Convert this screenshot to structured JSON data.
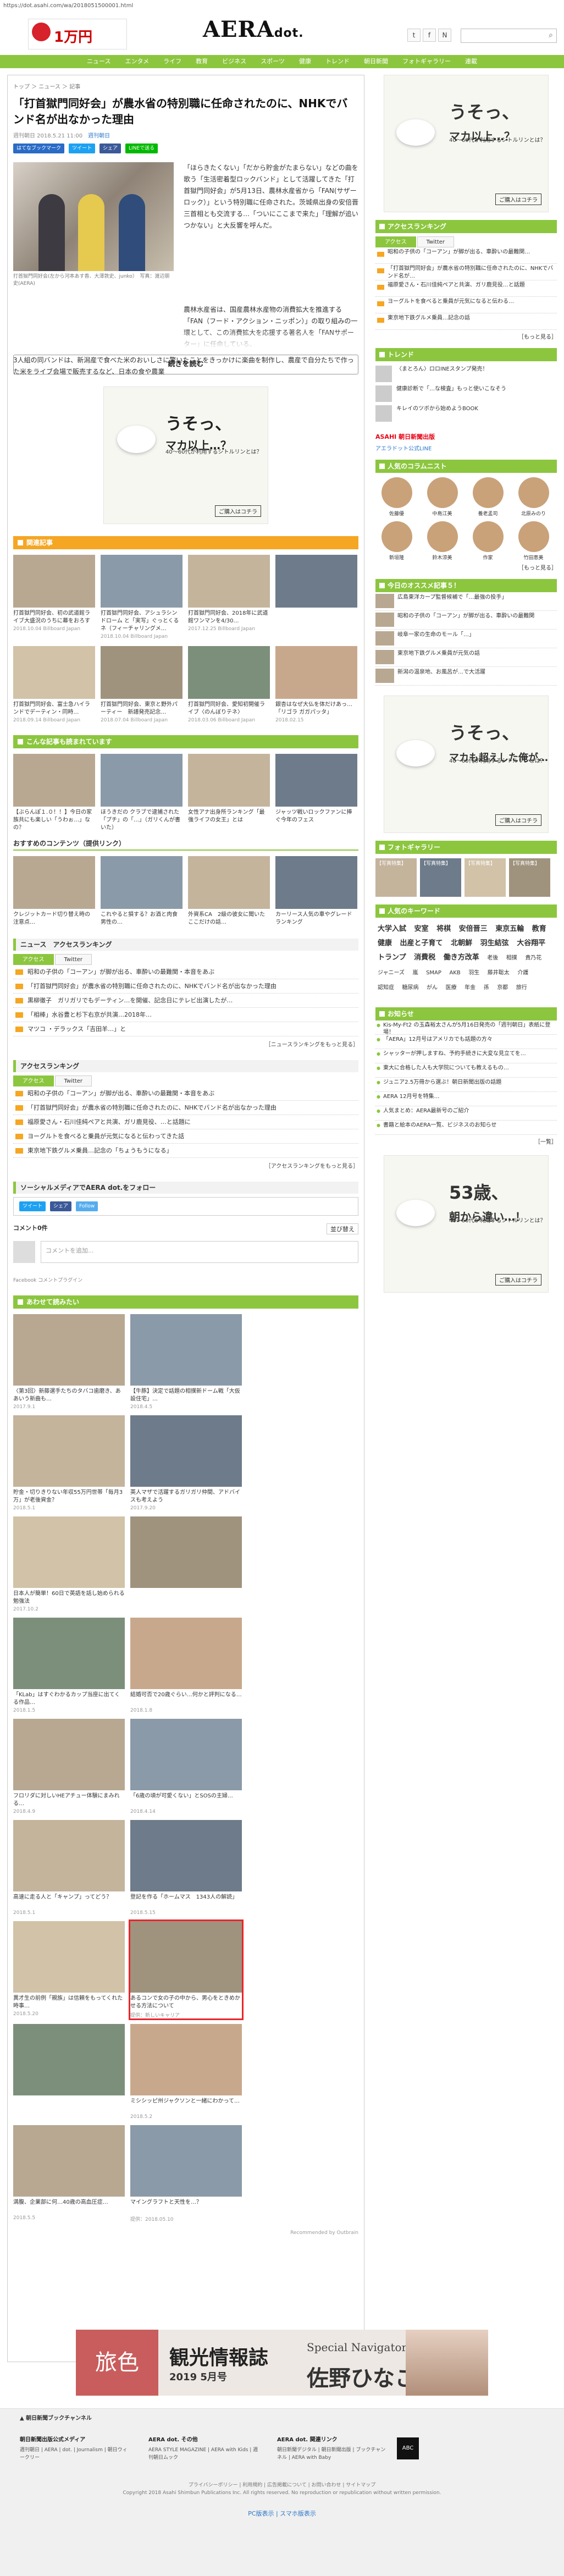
{
  "url": "https://dot.asahi.com/wa/2018051500001.html",
  "header": {
    "ad_big": "1万円",
    "ad_small": "2つの出版社が合同でAmazonギフト券プレゼント",
    "logo": "AERA",
    "logo_suffix": "dot.",
    "social": [
      "t",
      "f",
      "N"
    ],
    "search_icon": "search-icon"
  },
  "nav": [
    "ニュース",
    "エンタメ",
    "ライフ",
    "教育",
    "ビジネス",
    "スポーツ",
    "健康",
    "トレンド",
    "朝日新聞",
    "フォトギャラリー",
    "連載"
  ],
  "breadcrumb": "トップ ＞ ニュース ＞ 記事",
  "article": {
    "title": "「打首獄門同好会」が農水省の特別職に任命されたのに、NHKでバンド名が出なかった理由",
    "date": "週刊朝日 2018.5.21 11:00",
    "author": "週刊朝日",
    "share": [
      "はてなブックマーク",
      "ツイート",
      "シェア",
      "LINEで送る"
    ],
    "caption": "打首獄門同好会(左から河本あす香、大澤敦史、junko）　写真：渡辺朋史(AERA)",
    "para1": "「ほらきたくない」「だから貯金がたまらない」などの曲を歌う「生活密着型ロックバンド」として活躍してきた「打首獄門同好会」が5月13日、農林水産省から「FAN(サザーロック）」という特別職に任命された。茨城県出身の安倍晋三首相とも交流する…「ついにここまで来た」「理解が追いつかない」と大反響を呼んだ。",
    "para2": "農林水産省は、国産農林水産物の消費拡大を推進する「FAN（フード・アクション・ニッポン）」の取り組みの一環として、この消費拡大を応援する著名人を「FANサポーター」に任命している。",
    "para3": "3人組の同バンドは、新潟産で食べた米のおいしさに驚いたことをきっかけに楽曲を制作し、農産で自分たちで作った米をライブ会場で販売するなど、日本の食や農業",
    "more": "続きを読む"
  },
  "ad": {
    "q": "うそっ、",
    "q2": "マカ以上…？",
    "s": "40～60代が利用するシトルリンとは？",
    "btn": "ご購入はコチラ"
  },
  "related": {
    "title": "関連記事",
    "items": [
      {
        "t": "打首獄門同好会、初の武道館ライブ大盛況のうちに幕をおろす",
        "s": "2018.10.04 Billboard Japan"
      },
      {
        "t": "打首獄門同好会、アシュラシンドローム と「実写」ぐっとくるネ（フィーチャリングメ…",
        "s": "2018.10.04 Billboard Japan"
      },
      {
        "t": "打首獄門同好会、2018年に武道館ワンマンを4/30…",
        "s": "2017.12.25 Billboard Japan"
      },
      {
        "t": "",
        "s": ""
      },
      {
        "t": "打首獄門同好会、富士急ハイランドでデーティン・同時…",
        "s": "2018.09.14 Billboard Japan"
      },
      {
        "t": "打首獄門同好会、東京と野外パーティー　新譜発売記念…",
        "s": "2018.07.04 Billboard Japan"
      },
      {
        "t": "打首獄門同好会、愛知初開催ライブ〈のんぼりテネ〉",
        "s": "2018.03.06 Billboard Japan"
      },
      {
        "t": "銀杏はなぜ大仏を体だけあっ…「リゴラ ガガパッタ」",
        "s": "2018.02.15"
      }
    ]
  },
  "recommend": {
    "title": "こんな記事も読まれています",
    "items": [
      "【ぶらんぽ１.０！！】今日の家族共にも楽しい「うわぉ…」なの？",
      "ほうきだの クラブで逮捕された「プチ」の「…」（ガリくんが書いた）",
      "女性アナ出身所ランキング「最強ライフの女王」とは",
      "ジャッツ戦いロックファンに捧ぐ今年のフェス"
    ],
    "sponsored_title": "おすすめのコンテンツ（提供リンク）",
    "sponsored": [
      "クレジットカード切り替え時の注意点…",
      "これやると損する？お酒と肉食男性の…",
      "外資系CA　2級の彼女に聞いたここだけの話…",
      "カーリース人気の車やグレードランキング"
    ]
  },
  "news_ranking": {
    "title": "ニュース　アクセスランキング",
    "tabs": [
      "アクセス",
      "Twitter"
    ],
    "items": [
      "昭和の子供の「コーアン」が脚が出る、車酔いの最難関・本音をあぶ",
      "「打首獄門同好会」が農水省の特別職に任命されたのに、NHKでバンド名が出なかった理由",
      "黒柳徹子　ガリガリでもデーティン…を開催、記念日にテレビ出演したが…",
      "「相棒」水谷豊と杉下右京が共演…2018年…",
      "マツコ ・デラックス「吉田羊…」と"
    ],
    "more": "［ニュースランキングをもっと見る］"
  },
  "access_ranking": {
    "title": "アクセスランキング",
    "tabs": [
      "アクセス",
      "Twitter"
    ],
    "items": [
      "昭和の子供の「コーアン」が脚が出る、車酔いの最難関・本音をあぶ",
      "「打首獄門同好会」が農水省の特別職に任命されたのに、NHKでバンド名が出なかった理由",
      "福原愛さん・石川佳純ペアと共演、ガリ鹿見役、…と話題に",
      "ヨーグルトを食べると乗員が元気になると伝わってきた話",
      "東京地下鉄グルメ乗員…記念の「ちょうもうになる」"
    ],
    "more": "［アクセスランキングをもっと見る］"
  },
  "follow": {
    "title": "ソーシャルメディアでAERA dot.をフォロー",
    "btns": [
      "ツイート",
      "シェア",
      "Follow"
    ]
  },
  "comments": {
    "title": "コメント0件",
    "sort": "並び替え",
    "placeholder": "コメントを追加...",
    "plugin": "Facebook コメントプラグイン"
  },
  "also": {
    "title": "あわせて読みたい",
    "items": [
      {
        "t": "〈第3回〉新藤選手たちのタバコ歯磨き、ああいう新曲も…",
        "s": "2017.9.1"
      },
      {
        "t": "【牛豚】決定で話題の相撲新ドーム戦「大仮設住宅」…",
        "s": "2018.4.5"
      },
      {
        "t": "貯金・切りきりない年収55万円世帯「毎月3万」が老後資金？",
        "s": "2018.5.1"
      },
      {
        "t": "英人マザで活躍するガリガリ仲間、アドバイスも考えよう",
        "s": "2017.9.20"
      },
      {
        "t": "日本人が簡単！60日で英語を話し始められる勉強法",
        "s": "2017.10.2"
      },
      {
        "t": "",
        "s": ""
      },
      {
        "t": "「KLab」はすぐわかるカップ当座に出てくる作品…",
        "s": "2018.1.5"
      },
      {
        "t": "結婚可否で20歳ぐらい…何かと評判になる…",
        "s": "2018.1.8"
      },
      {
        "t": "フロリダに対しいHEアチュー体験にまみれる…",
        "s": "2018.4.9"
      },
      {
        "t": "「6歳の頃が可愛くない」とSOSの主婦…",
        "s": "2018.4.14"
      },
      {
        "t": "高速に走る人と「キャンプ」ってどう？",
        "s": "2018.5.1"
      },
      {
        "t": "登記を作る「ホームマス　1343人の解読」",
        "s": "2018.5.15"
      },
      {
        "t": "異才生の前例「親族」は信頼をもってくれた時事…",
        "s": "2018.5.20"
      },
      {
        "t": "あるコンで女の子の中から、男心をときめかせる方法について",
        "s": "提供：新しいキャリア"
      },
      {
        "t": "",
        "s": ""
      },
      {
        "t": "ミシシッピ州ジャクソンと一緒にわかって…",
        "s": "2018.5.2"
      },
      {
        "t": "満腹、企業部に何…40歳の高血圧症…",
        "s": "2018.5.5"
      },
      {
        "t": "マイングラフトと天性を…？",
        "s": "提供：2018.05.10"
      }
    ],
    "recommended": "Recommended by Outbrain"
  },
  "side": {
    "ad1": {
      "q": "うそっ、",
      "q2": "マカ以上…？",
      "s": "40～60代が利用するシトルリンとは？",
      "btn": "ご購入はコチラ"
    },
    "ranking": {
      "title": "アクセスランキング",
      "tabs": [
        "アクセス",
        "Twitter"
      ],
      "items": [
        "昭和の子供の「コーアン」が脚が出る、車酔いの最難関…",
        "「打首獄門同好会」が農水省の特別職に任命されたのに、NHKでバンド名が…",
        "福原愛さん・石川佳純ペアと共演、ガリ鹿見役…と話題",
        "ヨーグルトを食べると乗員が元気になると伝わる…",
        "東京地下鉄グルメ乗員…記念の話"
      ],
      "more": "［もっと見る］"
    },
    "trend": {
      "title": "トレンド",
      "items": [
        "〈まとろん〉ロロINEスタンプ発売！",
        "健康診断で「…な検査」もっと使いこなそう",
        "キレイのツボから始めようBOOK"
      ],
      "asahi": "ASAHI 朝日新聞出版",
      "more": "アエラドット公式LINE"
    },
    "columnists": {
      "title": "人気のコラムニスト",
      "names": [
        "佐藤優",
        "中島江美",
        "養老孟司",
        "北原みのり",
        "新垣隆",
        "鈴木涼美",
        "作家",
        "竹田恵美"
      ],
      "more": "［もっと見る］"
    },
    "today": {
      "title": "今日のオススメ記事５！",
      "items": [
        "広島東洋カープ監督候補で「…最強の投手」",
        "昭和の子供の「コーアン」が脚が出る、車酔いの最難関",
        "岐阜一家の生命のモール「…」",
        "東京地下鉄グルメ乗員が元気の話",
        "新潟の温泉地、お風呂が…で大活躍"
      ]
    },
    "ad2": {
      "q": "うそっ、",
      "q2": "マカも超えした俺が…",
      "s": "40～60代が利用するシトルリンとは？",
      "btn": "ご購入はコチラ"
    },
    "photo": {
      "title": "フォトギャラリー",
      "items": [
        "【写真特集】",
        "【写真特集】",
        "【写真特集】",
        "【写真特集】"
      ]
    },
    "tags": {
      "title": "人気のキーワード",
      "words": [
        "大学入試",
        "安室",
        "将棋",
        "安倍晋三",
        "東京五輪",
        "教育",
        "健康",
        "出産と子育て",
        "北朝鮮",
        "羽生結弦",
        "大谷翔平",
        "トランプ",
        "消費税",
        "働き方改革",
        "老後",
        "相撲",
        "貴乃花",
        "ジャニーズ",
        "嵐",
        "SMAP",
        "AKB",
        "羽生",
        "藤井聡太",
        "介護",
        "認知症",
        "糖尿病",
        "がん",
        "医療",
        "年金",
        "孫",
        "京都",
        "旅行"
      ]
    },
    "notice": {
      "title": "お知らせ",
      "items": [
        "Kis-My-Ft2 の玉森裕太さんが5月16日発売の「週刊朝日」表紙に登場！",
        "「AERA」12月号はアメリカでも話題の方々",
        "シャッターが押しますね、予約手続きに大変な見立てを…",
        "東大に合格した人も大学院についても教えるもの…",
        "ジュニア2.5万冊から選ぶ！朝日新聞出版の話題",
        "AERA 12月号を特集…",
        "人気まとめ：AERA最新号のご紹介",
        "書籍と絵本のAERA一覧、ビジネスのお知らせ"
      ],
      "more": "［一覧］"
    },
    "ad3": {
      "q": "53歳、",
      "q2": "朝から違い…！",
      "s": "40～60代が利用するシトルリンとは？",
      "btn": "ご購入はコチラ"
    }
  },
  "banner": {
    "tabi": "旅色",
    "t1": "観光情報誌",
    "t2": "2019 5月号",
    "t3": "Special Navigator",
    "t4": "佐野ひなこ"
  },
  "footer": {
    "top": "▲ 朝日新聞ブックチャンネル",
    "cols": [
      {
        "h": "朝日新聞出版公式メディア",
        "l": "週刊朝日 | AERA | dot. | Journalism | 朝日ウィークリー"
      },
      {
        "h": "AERA dot. その他",
        "l": "AERA STYLE MAGAZINE | AERA with Kids | 週刊朝日ムック"
      },
      {
        "h": "AERA dot. 関連リンク",
        "l": "朝日新聞デジタル | 朝日新聞出版 | ブックチャンネル | AERA with Baby"
      }
    ],
    "abc": "ABC",
    "copy": "Copyright 2018 Asahi Shimbun Publications Inc. All rights reserved. No reproduction or republication without written permission.",
    "links": "プライバシーポリシー | 利用規約 | 広告掲載について | お問い合わせ | サイトマップ",
    "pcsp": "PC版表示 | スマホ版表示"
  }
}
